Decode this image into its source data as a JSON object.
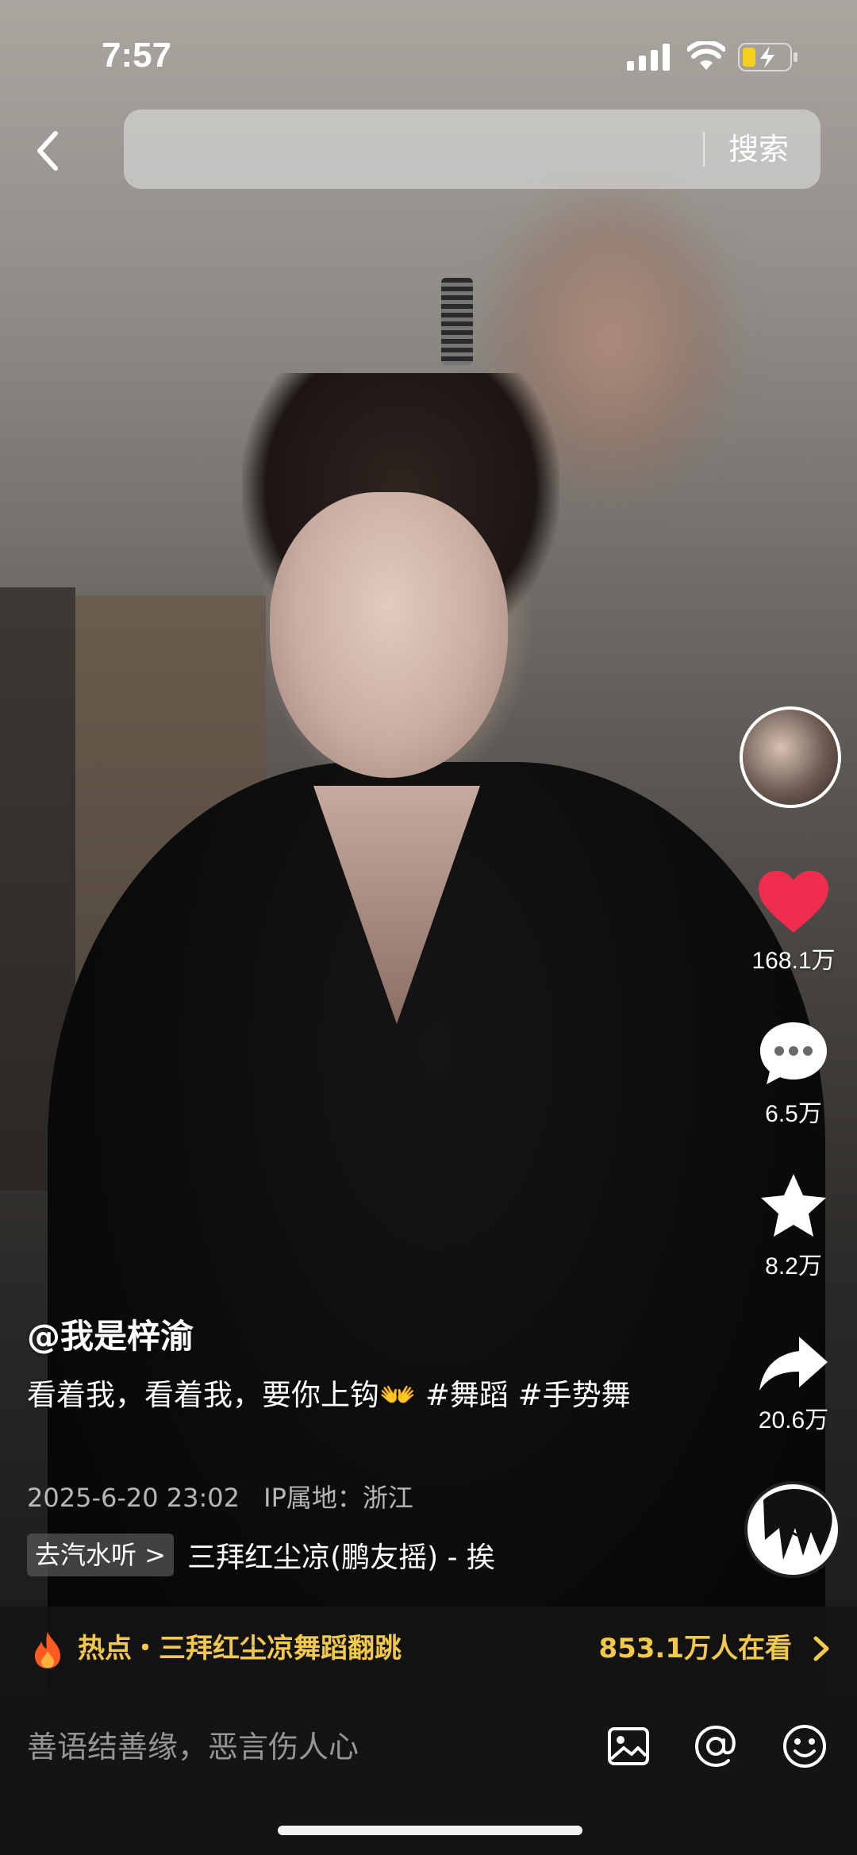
{
  "status_bar": {
    "time": "7:57"
  },
  "search": {
    "placeholder": "",
    "button_label": "搜索"
  },
  "actions": {
    "likes": "168.1万",
    "comments": "6.5万",
    "favorites": "8.2万",
    "shares": "20.6万"
  },
  "post": {
    "author": "@我是梓渝",
    "caption": "看着我，看着我，要你上钩👐 #舞蹈 #手势舞",
    "date": "2025-6-20 23:02",
    "ip_location": "IP属地：浙江"
  },
  "music": {
    "chip_label": "去汽水听 >",
    "title": "三拜红尘凉(鹏友摇) - 挨"
  },
  "hot": {
    "label": "热点・三拜红尘凉舞蹈翻跳",
    "viewers": "853.1万人在看"
  },
  "comment": {
    "placeholder": "善语结善缘，恶言伤人心"
  },
  "colors": {
    "like": "#ee2d4f",
    "hot": "#f3c94b",
    "bottom_bar": "#141414"
  },
  "icons": [
    "back-icon",
    "heart-icon",
    "comment-icon",
    "star-icon",
    "share-icon",
    "fire-icon",
    "image-icon",
    "at-icon",
    "emoji-icon"
  ]
}
